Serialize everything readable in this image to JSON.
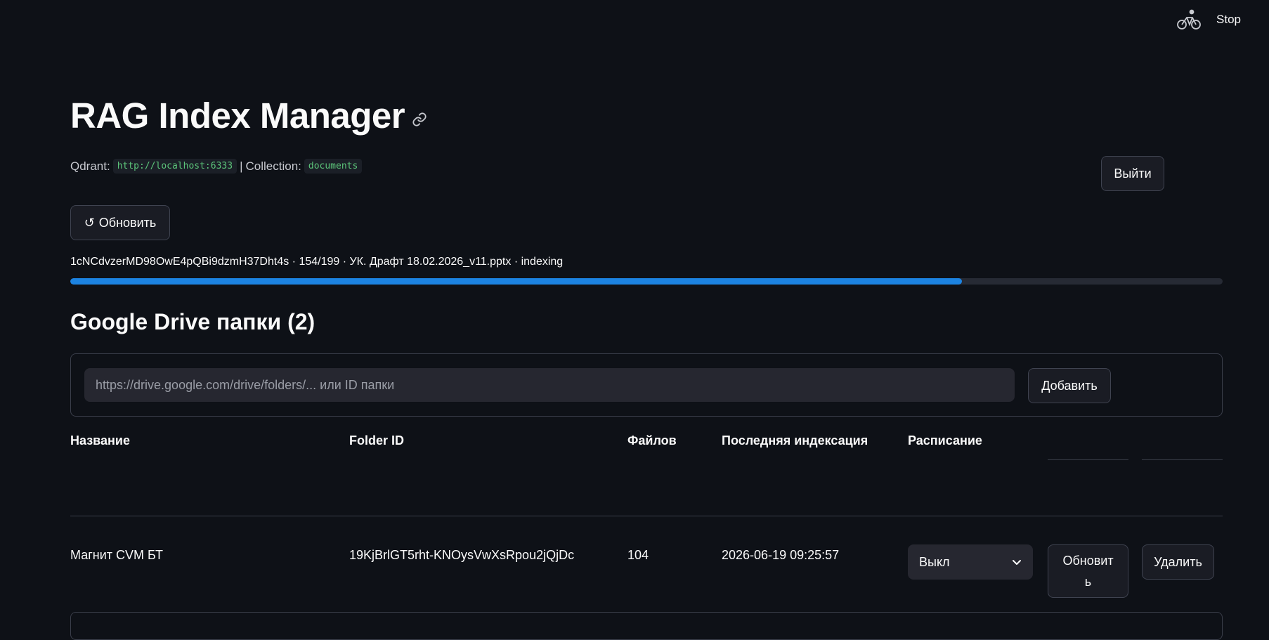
{
  "header": {
    "stop_label": "Stop",
    "status_icon": "bicycle-running-icon"
  },
  "page": {
    "title": "RAG Index Manager",
    "anchor_icon": "link-icon"
  },
  "info": {
    "qdrant_label": "Qdrant:",
    "qdrant_url": "http://localhost:6333",
    "separator": "|",
    "collection_label": "Collection:",
    "collection_name": "documents"
  },
  "buttons": {
    "exit": "Выйти",
    "refresh_icon": "↺",
    "refresh": "Обновить"
  },
  "progress": {
    "text": "1cNCdvzerMD98OwE4pQBi9dzmH37Dht4s · 154/199 · УК. Драфт 18.02.2026_v11.pptx · indexing",
    "value": 0.7739,
    "color": "#1c83e1"
  },
  "section": {
    "title": "Google Drive папки (2)"
  },
  "form": {
    "placeholder": "https://drive.google.com/drive/folders/... или ID папки",
    "add_label": "Добавить"
  },
  "table": {
    "columns": [
      "Название",
      "Folder ID",
      "Файлов",
      "Последняя индексация",
      "Расписание"
    ],
    "rows": [
      {
        "name": "Магнит CVM БТ",
        "folder_id": "19KjBrlGT5rht-KNOysVwXsRpou2jQjDc",
        "files": "104",
        "last_indexed": "2026-06-19 09:25:57",
        "schedule": "Выкл",
        "refresh_label_line1": "Обновит",
        "refresh_label_line2": "ь",
        "delete_label": "Удалить"
      }
    ]
  }
}
